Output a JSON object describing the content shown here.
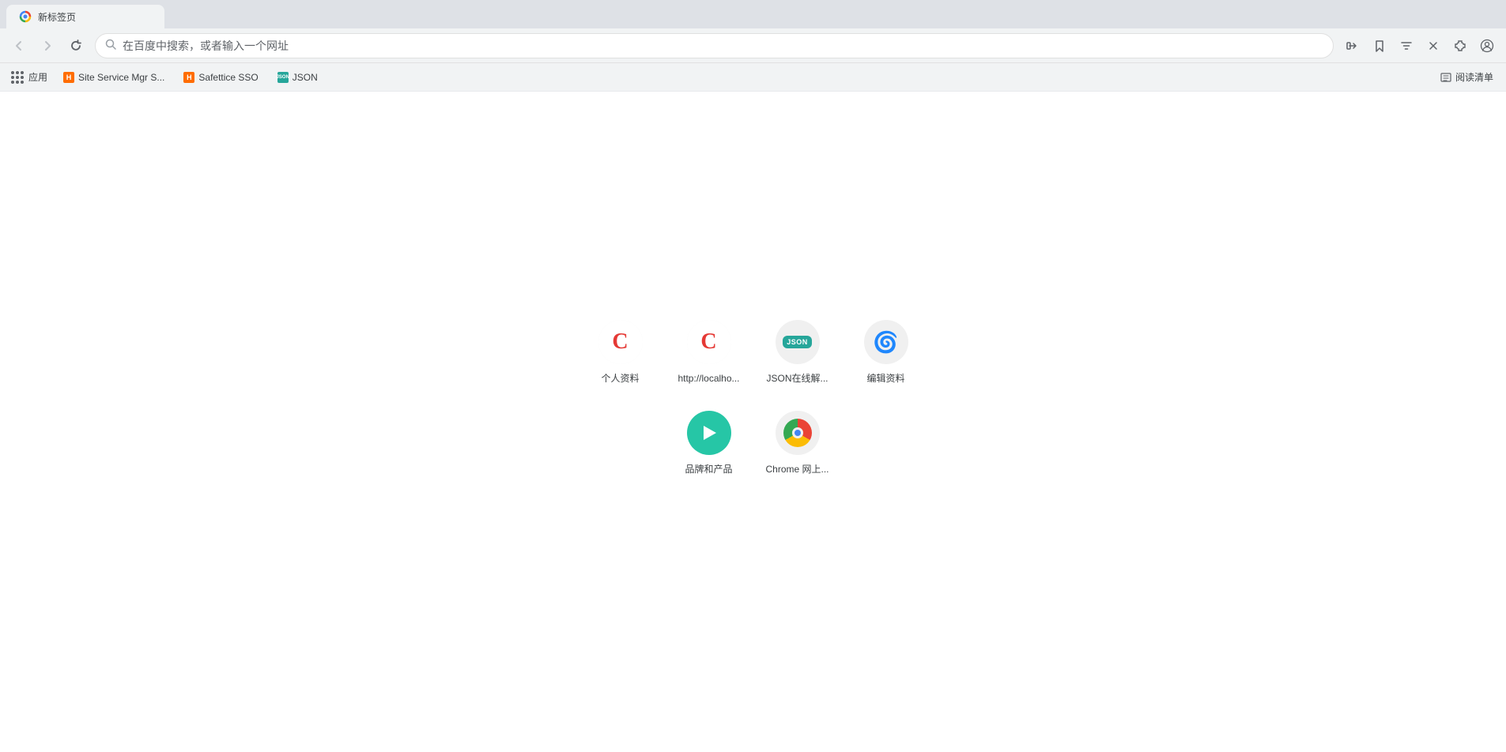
{
  "browser": {
    "tab": {
      "title": "新标签页"
    },
    "addressBar": {
      "placeholder": "在百度中搜索，或者输入一个网址",
      "value": "在百度中搜索，或者输入一个网址"
    },
    "bookmarks": [
      {
        "id": "apps",
        "label": "应用"
      },
      {
        "id": "site-service",
        "label": "Site Service Mgr S...",
        "color": "#e53935"
      },
      {
        "id": "safettice",
        "label": "Safettice SSO",
        "color": "#e53935"
      },
      {
        "id": "json",
        "label": "JSON",
        "color": "#26a69a"
      }
    ],
    "readerMode": "阅读清单"
  },
  "newTab": {
    "shortcuts": {
      "row1": [
        {
          "id": "profile",
          "label": "个人资料",
          "iconType": "c-red"
        },
        {
          "id": "localhost",
          "label": "http://localho...",
          "iconType": "c-red"
        },
        {
          "id": "json-online",
          "label": "JSON在线解...",
          "iconType": "json-green"
        },
        {
          "id": "weibo",
          "label": "编辑资料",
          "iconType": "weibo"
        }
      ],
      "row2": [
        {
          "id": "brand",
          "label": "品牌和产品",
          "iconType": "play-green"
        },
        {
          "id": "chrome-web",
          "label": "Chrome 网上...",
          "iconType": "chrome"
        }
      ]
    }
  },
  "icons": {
    "back": "←",
    "forward": "→",
    "reload": "↺",
    "share": "⎋",
    "star": "☆",
    "filter": "▽",
    "close_x": "✕",
    "extensions": "⬡",
    "profile": "◯",
    "apps": "⋮⋮⋮",
    "reader": "≡"
  }
}
